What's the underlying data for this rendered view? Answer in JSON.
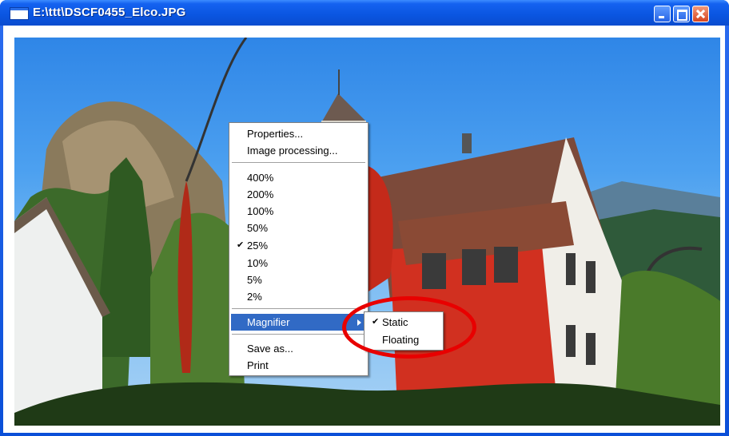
{
  "window": {
    "title": "E:\\ttt\\DSCF0455_Elco.JPG",
    "icon": "image-window-icon",
    "controls": {
      "minimize": "minimize-icon",
      "maximize": "maximize-icon",
      "close": "close-icon"
    }
  },
  "context_menu": {
    "items": [
      {
        "label": "Properties...",
        "checked": false
      },
      {
        "label": "Image processing...",
        "checked": false
      },
      {
        "label": "400%",
        "checked": false
      },
      {
        "label": "200%",
        "checked": false
      },
      {
        "label": "100%",
        "checked": false
      },
      {
        "label": "50%",
        "checked": false
      },
      {
        "label": "25%",
        "checked": true
      },
      {
        "label": "10%",
        "checked": false
      },
      {
        "label": "5%",
        "checked": false
      },
      {
        "label": "2%",
        "checked": false
      },
      {
        "label": "Magnifier",
        "highlighted": true,
        "has_submenu": true
      },
      {
        "label": "Save as...",
        "checked": false
      },
      {
        "label": "Print",
        "checked": false
      }
    ],
    "check_glyph": "✔"
  },
  "magnifier_submenu": {
    "items": [
      {
        "label": "Static",
        "checked": true
      },
      {
        "label": "Floating",
        "checked": false
      }
    ]
  },
  "annotation": {
    "color": "#e80000"
  },
  "colors": {
    "menu_highlight": "#316ac5",
    "titlebar": "#0a55e0"
  }
}
